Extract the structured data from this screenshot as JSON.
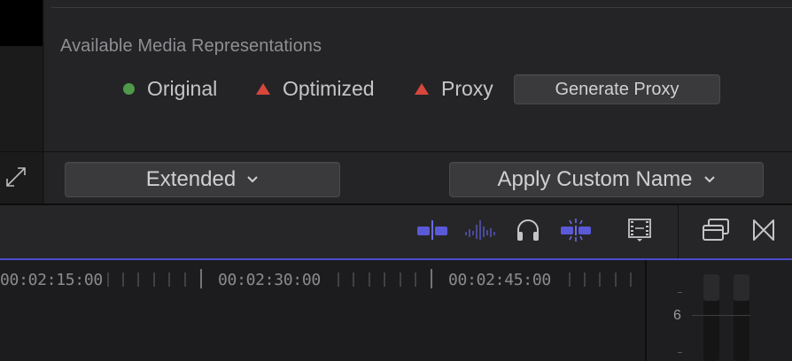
{
  "inspector": {
    "section_title": "Available Media Representations",
    "representations": [
      {
        "label": "Original",
        "status": "available",
        "marker": "green-dot-icon",
        "color": "#4f9a4a"
      },
      {
        "label": "Optimized",
        "status": "missing",
        "marker": "red-triangle-icon",
        "color": "#d8473c"
      },
      {
        "label": "Proxy",
        "status": "missing",
        "marker": "red-triangle-icon",
        "color": "#d8473c"
      }
    ],
    "generate_proxy_label": "Generate Proxy"
  },
  "bottom_bar": {
    "view_select_label": "Extended",
    "name_select_label": "Apply Custom Name",
    "chevron": "⌄"
  },
  "timeline_toolbar": {
    "icons": [
      "clip-appearance-icon",
      "audio-waveform-icon",
      "headphones-icon",
      "skimming-icon",
      "clip-filmstrip-icon",
      "window-layout-icon",
      "transitions-icon"
    ]
  },
  "ruler": {
    "timecodes": [
      "00:02:15:00",
      "00:02:30:00",
      "00:02:45:00"
    ]
  },
  "audio_meter": {
    "scale_label": "6"
  },
  "accent_color": "#4b4bd0"
}
